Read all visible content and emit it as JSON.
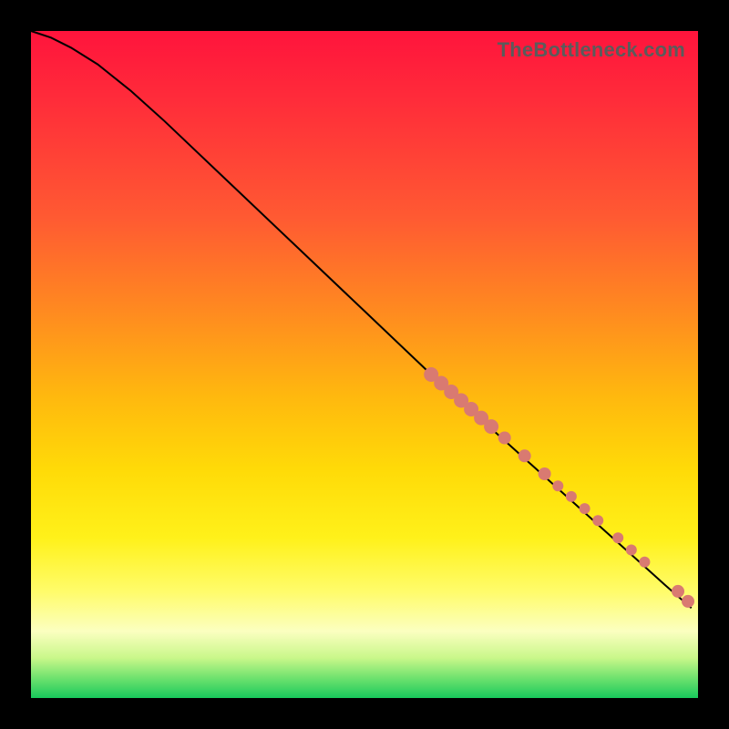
{
  "watermark": "TheBottleneck.com",
  "colors": {
    "dot": "#d97a71",
    "line": "#000000",
    "frame": "#000000"
  },
  "chart_data": {
    "type": "line",
    "title": "",
    "xlabel": "",
    "ylabel": "",
    "xlim": [
      0,
      100
    ],
    "ylim": [
      0,
      100
    ],
    "grid": false,
    "legend": false,
    "series": [
      {
        "name": "curve",
        "x": [
          0,
          3,
          6,
          10,
          15,
          20,
          30,
          40,
          50,
          60,
          65,
          70,
          75,
          80,
          85,
          90,
          95,
          99
        ],
        "y": [
          100,
          99,
          97.5,
          95,
          91,
          86.5,
          77,
          67.5,
          58,
          48.5,
          44,
          39.5,
          35,
          30.5,
          26,
          21.5,
          17,
          13.5
        ]
      }
    ],
    "points": {
      "name": "markers",
      "x": [
        60,
        61.5,
        63,
        64.5,
        66,
        67.5,
        69,
        71,
        74,
        77,
        79,
        81,
        83,
        85,
        88,
        90,
        92,
        97,
        98.5
      ],
      "y": [
        48.5,
        47.2,
        45.9,
        44.6,
        43.3,
        42.0,
        40.7,
        39.0,
        36.3,
        33.6,
        31.8,
        30.2,
        28.4,
        26.6,
        24.0,
        22.2,
        20.4,
        16.0,
        14.5
      ],
      "r": [
        8,
        8,
        8,
        8,
        8,
        8,
        8,
        7,
        7,
        7,
        6,
        6,
        6,
        6,
        6,
        6,
        6,
        7,
        7
      ]
    }
  }
}
